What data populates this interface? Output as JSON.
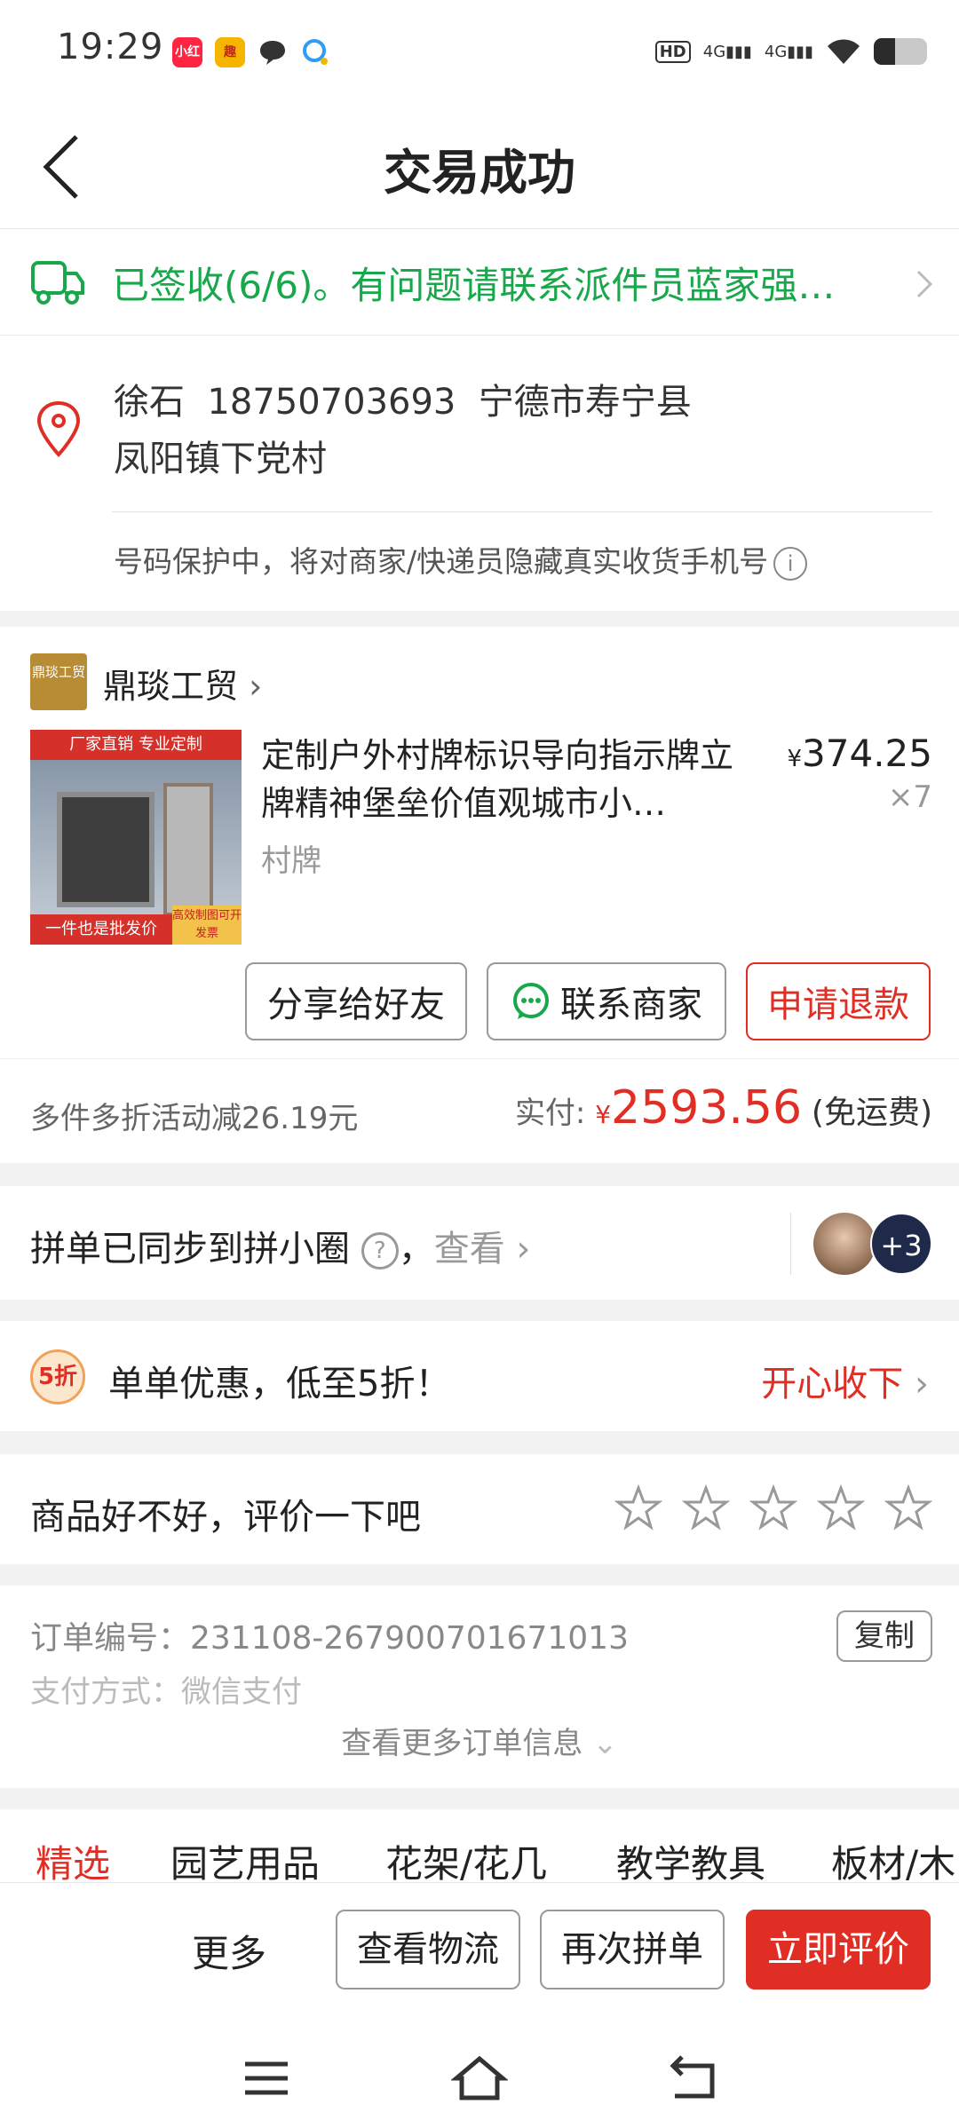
{
  "status_bar": {
    "time": "19:29",
    "app_icons": [
      {
        "name": "xiaohongshu-icon",
        "label": "小红书",
        "color": "#ff2442"
      },
      {
        "name": "qutoutiao-icon",
        "label": "趣",
        "color": "#f5b500"
      },
      {
        "name": "message-icon",
        "label": "",
        "color": "#333333"
      },
      {
        "name": "chat-icon",
        "label": "",
        "color": "#2f9cf5"
      }
    ],
    "hd": "HD",
    "signal1": "4G",
    "signal2": "4G"
  },
  "header": {
    "title": "交易成功"
  },
  "logistics": {
    "text": "已签收(6/6)。有问题请联系派件员蓝家强…"
  },
  "address": {
    "line1": "徐石  18750703693  宁德市寿宁县",
    "line2": "凤阳镇下党村",
    "protect_note": "号码保护中，将对商家/快递员隐藏真实收货手机号"
  },
  "order": {
    "shop_logo_text": "鼎琰工贸",
    "shop_name": "鼎琰工贸",
    "image_top_text": "厂家直销  专业定制",
    "image_bottom_text": "一件也是批发价",
    "image_badge_text": "高效制图可开发票",
    "product_title": "定制户外村牌标识导向指示牌立牌精神堡垒价值观城市小…",
    "product_tag": "村牌",
    "price_symbol": "¥",
    "price": "374.25",
    "quantity": "×7",
    "buttons": {
      "share": "分享给好友",
      "contact": "联系商家",
      "refund": "申请退款"
    },
    "discount_text": "多件多折活动减26.19元",
    "paid_label": "实付:",
    "paid_symbol": "¥",
    "paid_amount": "2593.56",
    "shipping": "(免运费)"
  },
  "pin": {
    "text": "拼单已同步到拼小圈",
    "question": "?",
    "comma": "，",
    "look": "查看",
    "avatar_more": "+3"
  },
  "promo": {
    "icon_text": "5折",
    "text": "单单优惠，低至5折！",
    "action": "开心收下"
  },
  "rating": {
    "text": "商品好不好，评价一下吧",
    "stars": 5
  },
  "meta": {
    "order_no": "订单编号：231108-267900701671013",
    "payment": "支付方式：微信支付",
    "copy": "复制",
    "more": "查看更多订单信息"
  },
  "categories": [
    "精选",
    "园艺用品",
    "花架/花几",
    "教学教具",
    "板材/木"
  ],
  "bottom_bar": {
    "more": "更多",
    "logistics": "查看物流",
    "rebuy": "再次拼单",
    "review": "立即评价"
  },
  "colors": {
    "accent_red": "#e02e24",
    "logistics_green": "#18a84b"
  }
}
